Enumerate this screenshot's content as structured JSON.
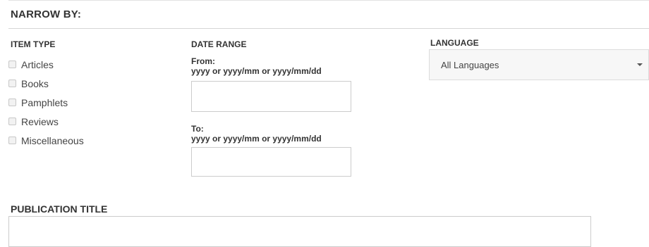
{
  "narrow_by": "NARROW BY:",
  "item_type": {
    "heading": "ITEM TYPE",
    "options": [
      "Articles",
      "Books",
      "Pamphlets",
      "Reviews",
      "Miscellaneous"
    ]
  },
  "date_range": {
    "heading": "DATE RANGE",
    "from_label": "From:",
    "from_hint": "yyyy or yyyy/mm or yyyy/mm/dd",
    "from_value": "",
    "to_label": "To:",
    "to_hint": "yyyy or yyyy/mm or yyyy/mm/dd",
    "to_value": ""
  },
  "language": {
    "heading": "LANGUAGE",
    "selected": "All Languages"
  },
  "publication_title": {
    "heading": "PUBLICATION TITLE",
    "value": ""
  }
}
